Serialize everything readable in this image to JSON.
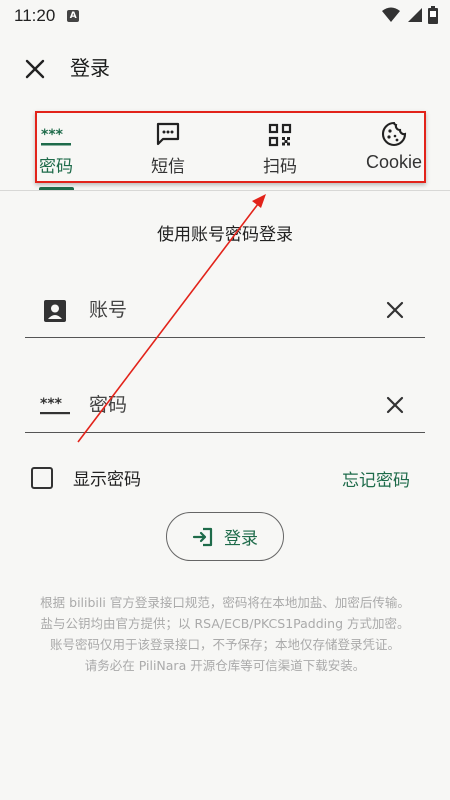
{
  "status_bar": {
    "time": "11:20",
    "notification_letter": "A"
  },
  "header": {
    "title": "登录"
  },
  "tabs": [
    {
      "label": "密码",
      "icon": "password-icon",
      "active": true
    },
    {
      "label": "短信",
      "icon": "sms-icon",
      "active": false
    },
    {
      "label": "扫码",
      "icon": "qr-code-icon",
      "active": false
    },
    {
      "label": "Cookie",
      "icon": "cookie-icon",
      "active": false
    }
  ],
  "form": {
    "section_title": "使用账号密码登录",
    "account_placeholder": "账号",
    "password_placeholder": "密码",
    "show_password_label": "显示密码",
    "forgot_password_label": "忘记密码",
    "login_button_label": "登录"
  },
  "footnote": [
    "根据 bilibili 官方登录接口规范，密码将在本地加盐、加密后传输。",
    "盐与公钥均由官方提供；以 RSA/ECB/PKCS1Padding 方式加密。",
    "账号密码仅用于该登录接口，不予保存；本地仅存储登录凭证。",
    "请务必在 PiliNara 开源仓库等可信渠道下载安装。"
  ],
  "colors": {
    "accent": "#1e6b4a",
    "annotation": "#e2231a",
    "background": "#f7f7f5"
  }
}
